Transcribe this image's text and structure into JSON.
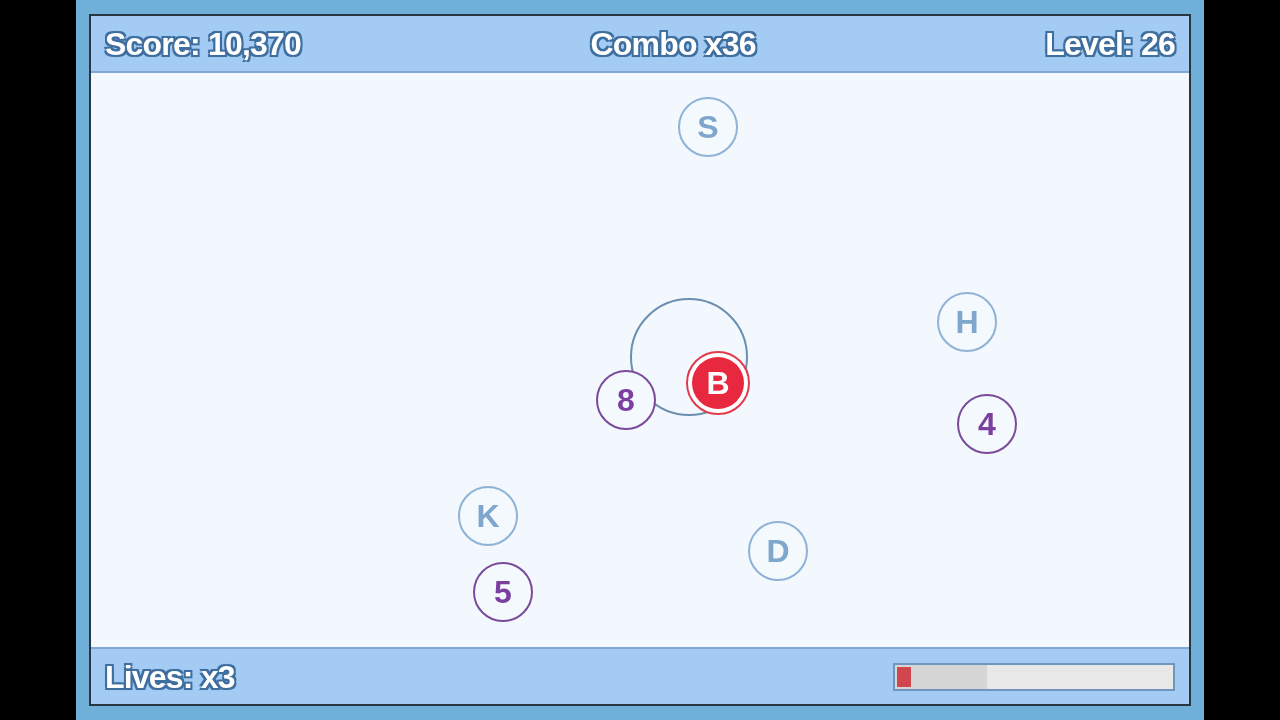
{
  "hud": {
    "score": "Score: 10,370",
    "combo": "Combo x36",
    "level_label": "Level: 26"
  },
  "bubbles": [
    {
      "char": "S",
      "kind": "letter",
      "selected": false
    },
    {
      "char": "H",
      "kind": "letter",
      "selected": false
    },
    {
      "char": "B",
      "kind": "letter",
      "selected": true
    },
    {
      "char": "8",
      "kind": "number",
      "selected": false
    },
    {
      "char": "4",
      "kind": "number",
      "selected": false
    },
    {
      "char": "K",
      "kind": "letter",
      "selected": false
    },
    {
      "char": "D",
      "kind": "letter",
      "selected": false
    },
    {
      "char": "5",
      "kind": "number",
      "selected": false
    }
  ],
  "footer": {
    "lives": "Lives: x3",
    "progress": {
      "level": 0.33
    }
  }
}
